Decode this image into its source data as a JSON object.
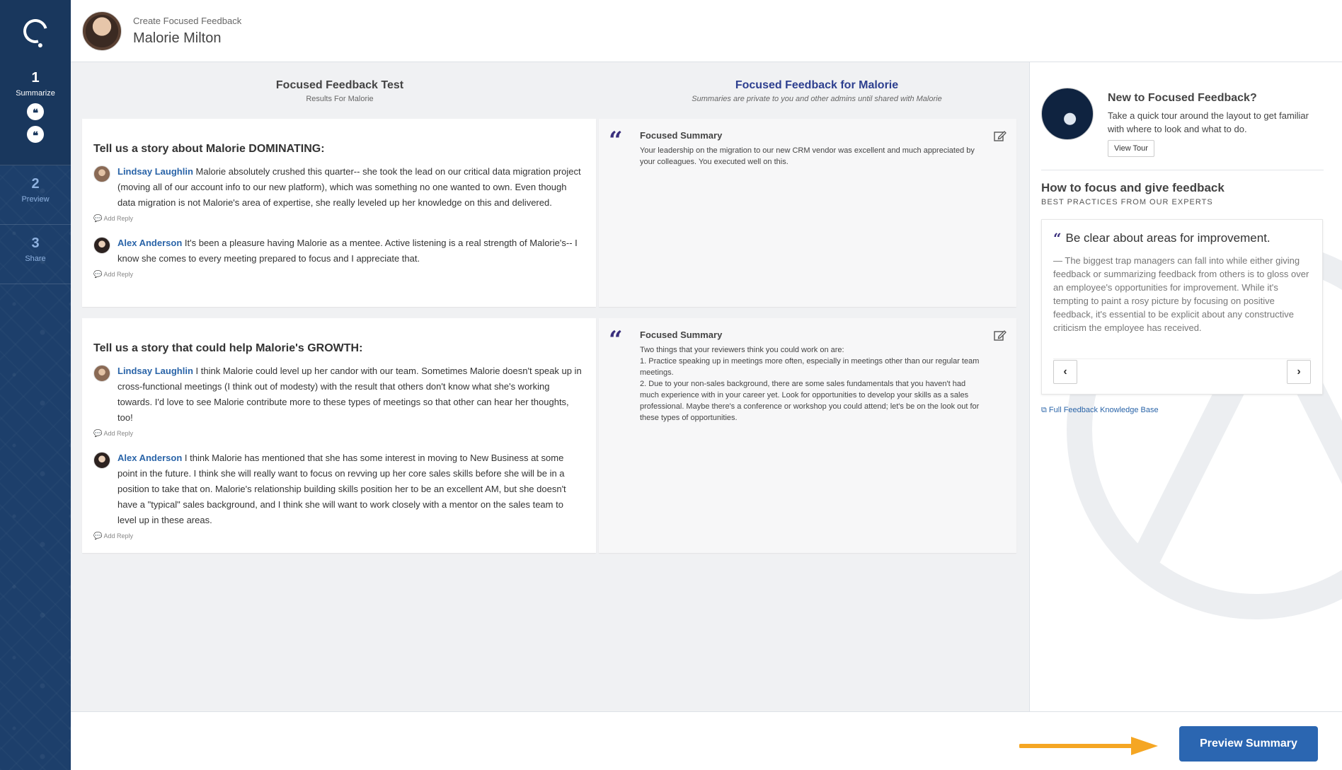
{
  "sidebar": {
    "steps": [
      {
        "num": "1",
        "label": "Summarize"
      },
      {
        "num": "2",
        "label": "Preview"
      },
      {
        "num": "3",
        "label": "Share"
      }
    ],
    "quote_glyph": "❝"
  },
  "header": {
    "subtitle": "Create Focused Feedback",
    "name": "Malorie Milton"
  },
  "left_column": {
    "title": "Focused Feedback Test",
    "subtitle": "Results For Malorie"
  },
  "middle_column": {
    "title": "Focused Feedback for Malorie",
    "subtitle": "Summaries are private to you and other admins until shared with Malorie"
  },
  "questions": [
    {
      "title": "Tell us a story about Malorie DOMINATING:",
      "responses": [
        {
          "author": "Lindsay Laughlin",
          "text": "Malorie absolutely crushed this quarter-- she took the lead on our critical data migration project (moving all of our account info to our new platform), which was something no one wanted to own. Even though data migration is not Malorie's area of expertise, she really leveled up her knowledge on this and delivered.",
          "reply_label": "Add Reply"
        },
        {
          "author": "Alex Anderson",
          "text": "It's been a pleasure having Malorie as a mentee. Active listening is a real strength of Malorie's-- I know she comes to every meeting prepared to focus and I appreciate that.",
          "reply_label": "Add Reply"
        }
      ],
      "summary_title": "Focused Summary",
      "summary_text": "Your leadership on the migration to our new CRM vendor was excellent and much appreciated by your colleagues. You executed well on this."
    },
    {
      "title": "Tell us a story that could help Malorie's GROWTH:",
      "responses": [
        {
          "author": "Lindsay Laughlin",
          "text": "I think Malorie could level up her candor with our team. Sometimes Malorie doesn't speak up in cross-functional meetings (I think out of modesty) with the result that others don't know what she's working towards. I'd love to see Malorie contribute more to these types of meetings so that other can hear her thoughts, too!",
          "reply_label": "Add Reply"
        },
        {
          "author": "Alex Anderson",
          "text": "I think Malorie has mentioned that she has some interest in moving to New Business at some point in the future. I think she will really want to focus on revving up her core sales skills before she will be in a position to take that on. Malorie's relationship building skills position her to be an excellent AM, but she doesn't have a \"typical\" sales background, and I think she will want to work closely with a mentor on the sales team to level up in these areas.",
          "reply_label": "Add Reply"
        }
      ],
      "summary_title": "Focused Summary",
      "summary_text": "Two things that your reviewers think you could work on are:\n1. Practice speaking up in meetings more often, especially in meetings other than our regular team meetings.\n2. Due to your non-sales background, there are some sales fundamentals that you haven't had much experience with in your career yet. Look for opportunities to develop your skills as a sales professional. Maybe there's a conference or workshop you could attend; let's be on the look out for these types of opportunities."
    }
  ],
  "right_panel": {
    "tour_title": "New to Focused Feedback?",
    "tour_text": "Take a quick tour around the layout to get familiar with where to look and what to do.",
    "tour_button": "View Tour",
    "howto_title": "How to focus and give feedback",
    "howto_subtitle": "BEST PRACTICES FROM OUR EXPERTS",
    "tip_title": "Be clear about areas for improvement.",
    "tip_text": "— The biggest trap managers can fall into while either giving feedback or summarizing feedback from others is to gloss over an employee's opportunities for improvement. While it's tempting to paint a rosy picture by focusing on positive feedback, it's essential to be explicit about any constructive criticism the employee has received.",
    "prev_glyph": "‹",
    "next_glyph": "›",
    "kb_link": "Full Feedback Knowledge Base"
  },
  "footer": {
    "preview_button": "Preview Summary"
  },
  "colors": {
    "sidebar": "#1d3f6b",
    "accent": "#2b66b1",
    "quote": "#3a2f7d",
    "arrow": "#f5a623"
  }
}
